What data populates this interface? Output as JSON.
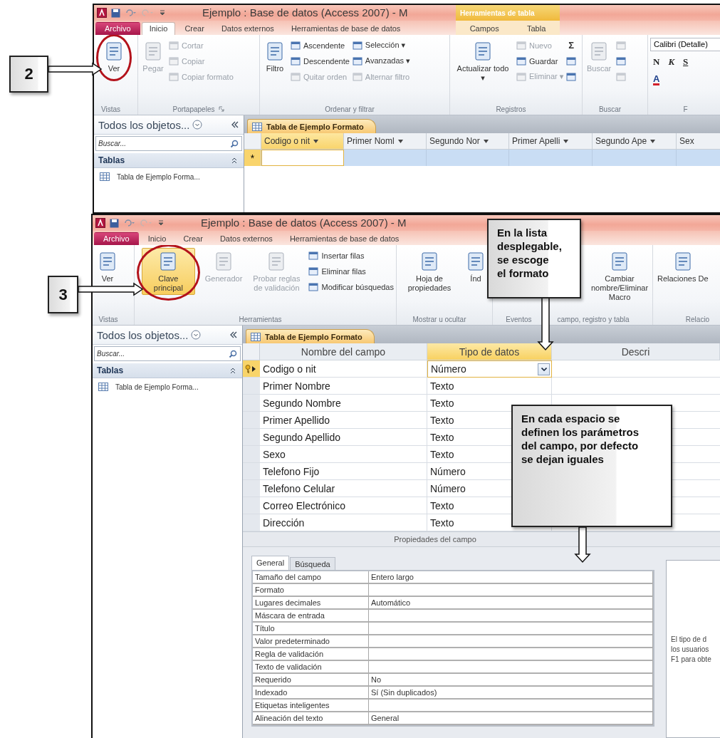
{
  "steps": [
    {
      "label": "2"
    },
    {
      "label": "3"
    }
  ],
  "notes": [
    {
      "text": "En la lista desplegable, se escoge el formato"
    },
    {
      "text": "En cada espacio se definen los parámetros del campo, por defecto se dejan iguales"
    }
  ],
  "windows": [
    {
      "title": "Ejemplo : Base de datos (Access 2007) - M",
      "context_header": "Herramientas de tabla",
      "tabs": [
        {
          "label": "Archivo",
          "kind": "file",
          "selected": false
        },
        {
          "label": "Inicio",
          "kind": "normal",
          "selected": true
        },
        {
          "label": "Crear",
          "kind": "normal",
          "selected": false
        },
        {
          "label": "Datos externos",
          "kind": "normal",
          "selected": false
        },
        {
          "label": "Herramientas de base de datos",
          "kind": "normal",
          "selected": false
        },
        {
          "label": "Campos",
          "kind": "contextual",
          "selected": false
        },
        {
          "label": "Tabla",
          "kind": "contextual",
          "selected": false
        }
      ],
      "ribbon": [
        {
          "labels": [
            "Vistas"
          ],
          "launcher": false,
          "columns": [
            {
              "kind": "large",
              "label": "Ver",
              "disabled": false,
              "pressed": false,
              "circled": true
            }
          ]
        },
        {
          "labels": [
            "Portapapeles"
          ],
          "launcher": true,
          "columns": [
            {
              "kind": "large",
              "label": "Pegar",
              "disabled": true,
              "pressed": false,
              "circled": false
            },
            {
              "kind": "stack",
              "items": [
                {
                  "kind": "labeled",
                  "label": "Cortar",
                  "disabled": true
                },
                {
                  "kind": "labeled",
                  "label": "Copiar",
                  "disabled": true
                },
                {
                  "kind": "labeled",
                  "label": "Copiar formato",
                  "disabled": true
                }
              ]
            }
          ]
        },
        {
          "labels": [
            "Ordenar y filtrar"
          ],
          "launcher": false,
          "columns": [
            {
              "kind": "large",
              "label": "Filtro",
              "disabled": false,
              "pressed": false,
              "circled": false
            },
            {
              "kind": "stack",
              "items": [
                {
                  "kind": "labeled",
                  "label": "Ascendente",
                  "disabled": false
                },
                {
                  "kind": "labeled",
                  "label": "Descendente",
                  "disabled": false
                },
                {
                  "kind": "labeled",
                  "label": "Quitar orden",
                  "disabled": true
                }
              ]
            },
            {
              "kind": "stack",
              "items": [
                {
                  "kind": "labeled",
                  "label": "Selección ▾",
                  "disabled": false
                },
                {
                  "kind": "labeled",
                  "label": "Avanzadas ▾",
                  "disabled": false
                },
                {
                  "kind": "labeled",
                  "label": "Alternar filtro",
                  "disabled": true
                }
              ]
            }
          ]
        },
        {
          "labels": [
            "Registros"
          ],
          "launcher": false,
          "columns": [
            {
              "kind": "large",
              "label": "Actualizar todo ▾",
              "disabled": false,
              "pressed": false,
              "circled": false
            },
            {
              "kind": "stack",
              "items": [
                {
                  "kind": "labeled",
                  "label": "Nuevo",
                  "disabled": true
                },
                {
                  "kind": "labeled",
                  "label": "Guardar",
                  "disabled": false
                },
                {
                  "kind": "labeled",
                  "label": "Eliminar ▾",
                  "disabled": true
                }
              ]
            },
            {
              "kind": "stack",
              "items": [
                {
                  "kind": "glyph",
                  "label": "Σ",
                  "disabled": false
                },
                {
                  "kind": "icon",
                  "disabled": false
                },
                {
                  "kind": "icon",
                  "disabled": false
                }
              ]
            }
          ]
        },
        {
          "labels": [
            "Buscar"
          ],
          "launcher": false,
          "columns": [
            {
              "kind": "large",
              "label": "Buscar",
              "disabled": true,
              "pressed": false,
              "circled": false
            },
            {
              "kind": "stack",
              "items": [
                {
                  "kind": "icon",
                  "disabled": true
                },
                {
                  "kind": "icon",
                  "disabled": false
                },
                {
                  "kind": "icon",
                  "disabled": true
                }
              ]
            }
          ]
        },
        {
          "labels": [
            "F"
          ],
          "launcher": false,
          "columns": [
            {
              "kind": "font",
              "value": "Calibri (Detalle)",
              "letters": [
                "N",
                "K",
                "S"
              ],
              "color_letter": "A"
            }
          ]
        }
      ],
      "nav": {
        "title": "Todos los objetos...",
        "search_placeholder": "Buscar...",
        "group": "Tablas",
        "items": [
          "Tabla de Ejemplo Forma..."
        ]
      },
      "doc_tab": "Tabla de Ejemplo Formato",
      "datasheet": {
        "columns": [
          {
            "label": "Codigo o nit",
            "selected": true,
            "menu": true
          },
          {
            "label": "Primer Noml",
            "selected": false,
            "menu": true
          },
          {
            "label": "Segundo Nor",
            "selected": false,
            "menu": true
          },
          {
            "label": "Primer Apelli",
            "selected": false,
            "menu": true
          },
          {
            "label": "Segundo Ape",
            "selected": false,
            "menu": true
          },
          {
            "label": "Sex",
            "selected": false,
            "menu": false
          }
        ],
        "new_row_marker": "*"
      }
    },
    {
      "title": "Ejemplo : Base de datos (Access 2007) - M",
      "tabs": [
        {
          "label": "Archivo",
          "kind": "file",
          "selected": false
        },
        {
          "label": "Inicio",
          "kind": "normal",
          "selected": false
        },
        {
          "label": "Crear",
          "kind": "normal",
          "selected": false
        },
        {
          "label": "Datos externos",
          "kind": "normal",
          "selected": false
        },
        {
          "label": "Herramientas de base de datos",
          "kind": "normal",
          "selected": false
        }
      ],
      "ribbon": [
        {
          "labels": [
            "Vistas"
          ],
          "launcher": false,
          "columns": [
            {
              "kind": "large",
              "label": "Ver",
              "disabled": false,
              "pressed": false,
              "circled": false
            }
          ]
        },
        {
          "labels": [
            "Herramientas"
          ],
          "launcher": false,
          "columns": [
            {
              "kind": "large",
              "label": "Clave principal",
              "disabled": false,
              "pressed": true,
              "circled": true
            },
            {
              "kind": "large",
              "label": "Generador",
              "disabled": true,
              "pressed": false,
              "circled": false
            },
            {
              "kind": "large",
              "label": "Probar reglas de validación",
              "disabled": true,
              "pressed": false,
              "circled": false
            },
            {
              "kind": "stack",
              "items": [
                {
                  "kind": "labeled",
                  "label": "Insertar filas",
                  "disabled": false
                },
                {
                  "kind": "labeled",
                  "label": "Eliminar filas",
                  "disabled": false
                },
                {
                  "kind": "labeled",
                  "label": "Modificar búsquedas",
                  "disabled": false
                }
              ]
            }
          ]
        },
        {
          "labels": [
            "Mostrar u ocultar"
          ],
          "launcher": false,
          "columns": [
            {
              "kind": "large",
              "label": "Hoja de propiedades",
              "disabled": false,
              "pressed": false,
              "circled": false
            },
            {
              "kind": "large",
              "label": "Índ",
              "disabled": false,
              "pressed": false,
              "circled": false
            }
          ]
        },
        {
          "labels": [
            "Eventos",
            "campo, registro y tabla"
          ],
          "launcher": false,
          "columns": [
            {
              "kind": "large",
              "label": "Cambiar nombre/Eliminar Macro",
              "disabled": false,
              "pressed": false,
              "circled": false
            }
          ]
        },
        {
          "labels": [
            "Relacio"
          ],
          "launcher": false,
          "columns": [
            {
              "kind": "large",
              "label": "Relaciones De",
              "disabled": false,
              "pressed": false,
              "circled": false
            }
          ]
        }
      ],
      "nav": {
        "title": "Todos los objetos...",
        "search_placeholder": "Buscar...",
        "group": "Tablas",
        "items": [
          "Tabla de Ejemplo Forma..."
        ]
      },
      "doc_tab": "Tabla de Ejemplo Formato",
      "design": {
        "columns": [
          {
            "label": "Nombre del campo",
            "selected": false
          },
          {
            "label": "Tipo de datos",
            "selected": true
          },
          {
            "label": "Descri",
            "selected": false
          }
        ],
        "rows": [
          {
            "name": "Codigo o nit",
            "type": "Número",
            "key": true,
            "selected": true
          },
          {
            "name": "Primer Nombre",
            "type": "Texto",
            "key": false,
            "selected": false
          },
          {
            "name": "Segundo Nombre",
            "type": "Texto",
            "key": false,
            "selected": false
          },
          {
            "name": "Primer Apellido",
            "type": "Texto",
            "key": false,
            "selected": false
          },
          {
            "name": "Segundo Apellido",
            "type": "Texto",
            "key": false,
            "selected": false
          },
          {
            "name": "Sexo",
            "type": "Texto",
            "key": false,
            "selected": false
          },
          {
            "name": "Telefono Fijo",
            "type": "Número",
            "key": false,
            "selected": false
          },
          {
            "name": "Telefono Celular",
            "type": "Número",
            "key": false,
            "selected": false
          },
          {
            "name": "Correo Electrónico",
            "type": "Texto",
            "key": false,
            "selected": false
          },
          {
            "name": "Dirección",
            "type": "Texto",
            "key": false,
            "selected": false
          }
        ],
        "section_label": "Propiedades del campo",
        "property_tabs": [
          {
            "label": "General",
            "selected": true
          },
          {
            "label": "Búsqueda",
            "selected": false
          }
        ],
        "properties": [
          {
            "label": "Tamaño del campo",
            "value": "Entero largo"
          },
          {
            "label": "Formato"
          },
          {
            "label": "Lugares decimales",
            "value": "Automático"
          },
          {
            "label": "Máscara de entrada"
          },
          {
            "label": "Título"
          },
          {
            "label": "Valor predeterminado"
          },
          {
            "label": "Regla de validación"
          },
          {
            "label": "Texto de validación"
          },
          {
            "label": "Requerido",
            "value": "No"
          },
          {
            "label": "Indexado",
            "value": "Sí (Sin duplicados)"
          },
          {
            "label": "Etiquetas inteligentes"
          },
          {
            "label": "Alineación del texto",
            "value": "General"
          }
        ],
        "help": [
          "El tipo de d",
          "los usuarios",
          "F1 para obte"
        ]
      }
    }
  ]
}
